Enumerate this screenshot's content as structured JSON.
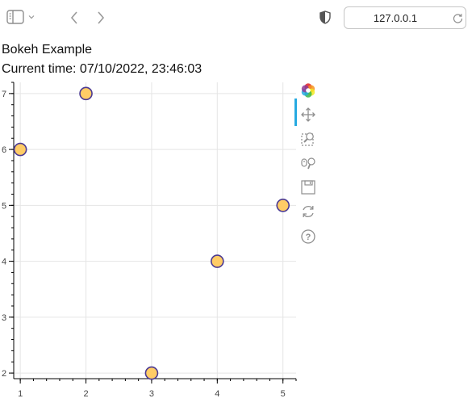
{
  "browser": {
    "url": "127.0.0.1"
  },
  "page": {
    "heading": "Bokeh Example",
    "time_line": "Current time: 07/10/2022, 23:46:03"
  },
  "bokeh_toolbar": {
    "tools": [
      "bokeh-logo-icon",
      "pan-icon",
      "box-zoom-icon",
      "wheel-zoom-icon",
      "save-icon",
      "reset-icon",
      "help-icon"
    ],
    "active_indicator_color": "#26aae1"
  },
  "chart_data": {
    "type": "scatter",
    "x": [
      1,
      2,
      3,
      4,
      5
    ],
    "y": [
      6,
      7,
      2,
      4,
      5
    ],
    "xlim": [
      0.9,
      5.2
    ],
    "ylim": [
      1.9,
      7.2
    ],
    "x_ticks": [
      "1",
      "2",
      "3",
      "4",
      "5"
    ],
    "y_ticks": [
      "2",
      "3",
      "4",
      "5",
      "6",
      "7"
    ],
    "grid": true,
    "marker": {
      "shape": "circle",
      "fill": "#ffcc66",
      "line": "#4b3a93"
    }
  }
}
